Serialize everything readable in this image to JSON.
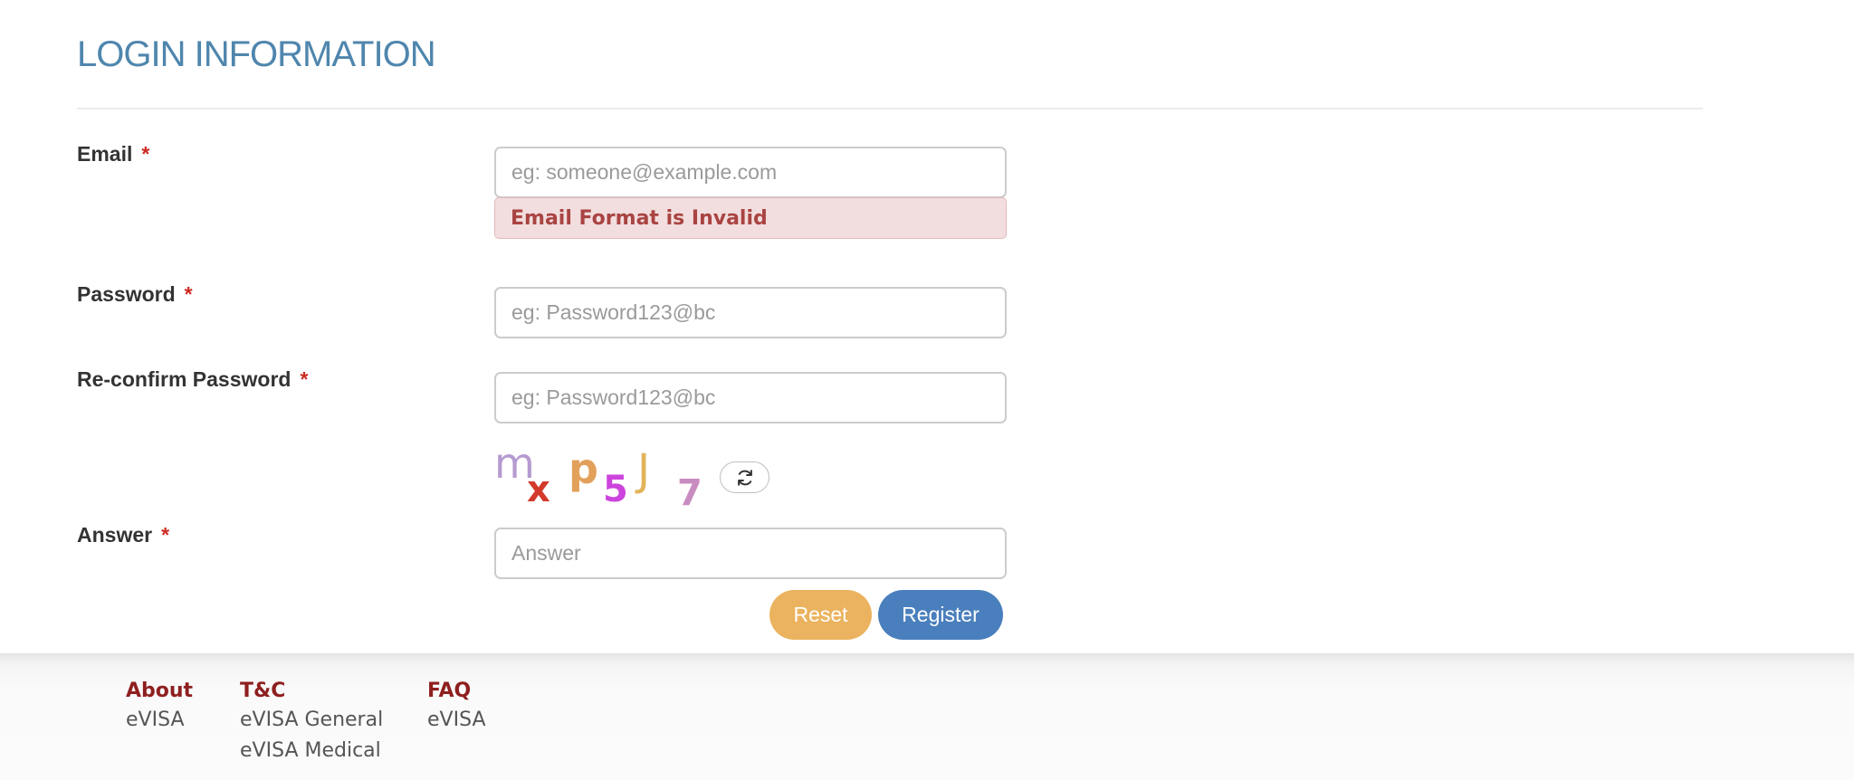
{
  "section": {
    "title": "LOGIN INFORMATION"
  },
  "form": {
    "required_marker": "*",
    "email": {
      "label": "Email",
      "placeholder": "eg: someone@example.com",
      "value": "",
      "error": "Email Format is Invalid"
    },
    "password": {
      "label": "Password",
      "placeholder": "eg: Password123@bc",
      "value": ""
    },
    "reconfirm": {
      "label": "Re-confirm Password",
      "placeholder": "eg: Password123@bc",
      "value": ""
    },
    "captcha": {
      "text": "mxp5J7",
      "refresh_icon": "refresh-icon"
    },
    "answer": {
      "label": "Answer",
      "placeholder": "Answer",
      "value": ""
    },
    "buttons": {
      "reset": "Reset",
      "register": "Register"
    }
  },
  "footer": {
    "columns": [
      {
        "heading": "About",
        "links": [
          "eVISA"
        ]
      },
      {
        "heading": "T&C",
        "links": [
          "eVISA General",
          "eVISA Medical"
        ]
      },
      {
        "heading": "FAQ",
        "links": [
          "eVISA"
        ]
      }
    ]
  },
  "colors": {
    "title": "#4f86ad",
    "required": "#cc2a22",
    "error_bg": "#f2dede",
    "error_text": "#a94442",
    "reset_button": "#ebb35f",
    "register_button": "#4a7fbd",
    "footer_heading": "#8f1f1f"
  }
}
